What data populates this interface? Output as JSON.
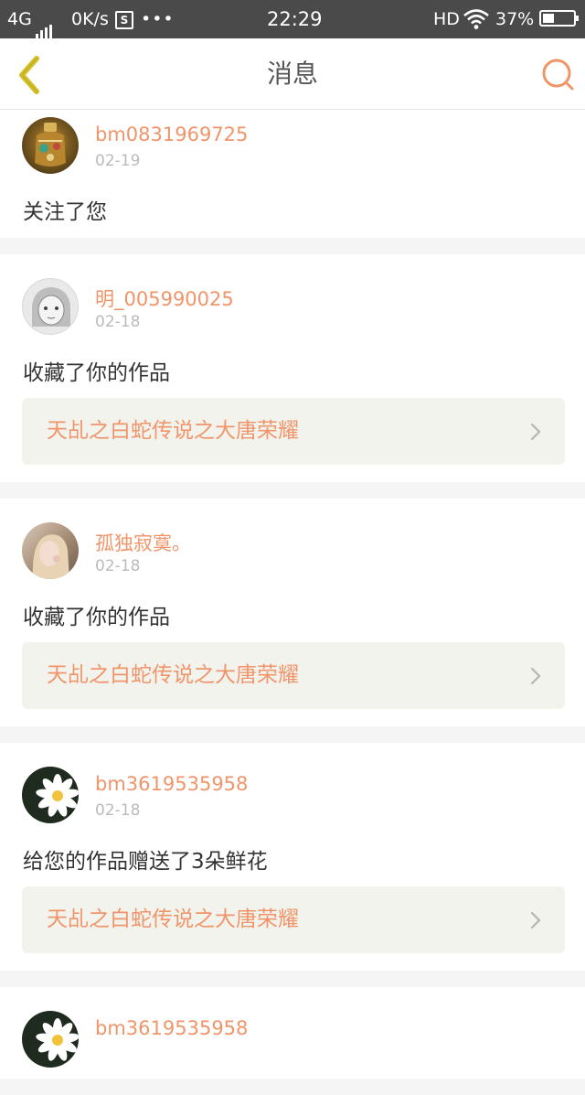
{
  "status_bar": {
    "network": "4G",
    "speed": "0K/s",
    "s_icon": "S",
    "more": "•••",
    "time": "22:29",
    "hd": "HD",
    "battery": "37%",
    "battery_level": 0.37
  },
  "header": {
    "title": "消息",
    "back_icon": "chevron-left-icon",
    "search_icon": "search-icon"
  },
  "colors": {
    "accent": "#f0956a",
    "back_icon": "#d4c02a",
    "status_bar_bg": "#4a4a4a",
    "link_bg": "#f3f3ee"
  },
  "messages": [
    {
      "username": "bm0831969725",
      "date": "02-19",
      "action": "关注了您",
      "avatar": "ornate-bottle-avatar"
    },
    {
      "username": "明_005990025",
      "date": "02-18",
      "action": "收藏了你的作品",
      "work": "天乩之白蛇传说之大唐荣耀",
      "avatar": "sketch-girl-avatar"
    },
    {
      "username": "孤独寂寞。",
      "date": "02-18",
      "action": "收藏了你的作品",
      "work": "天乩之白蛇传说之大唐荣耀",
      "avatar": "girl-photo-avatar"
    },
    {
      "username": "bm3619535958",
      "date": "02-18",
      "action": "给您的作品赠送了3朵鲜花",
      "work": "天乩之白蛇传说之大唐荣耀",
      "avatar": "daisy-avatar"
    },
    {
      "username": "bm3619535958",
      "avatar": "daisy-avatar"
    }
  ]
}
